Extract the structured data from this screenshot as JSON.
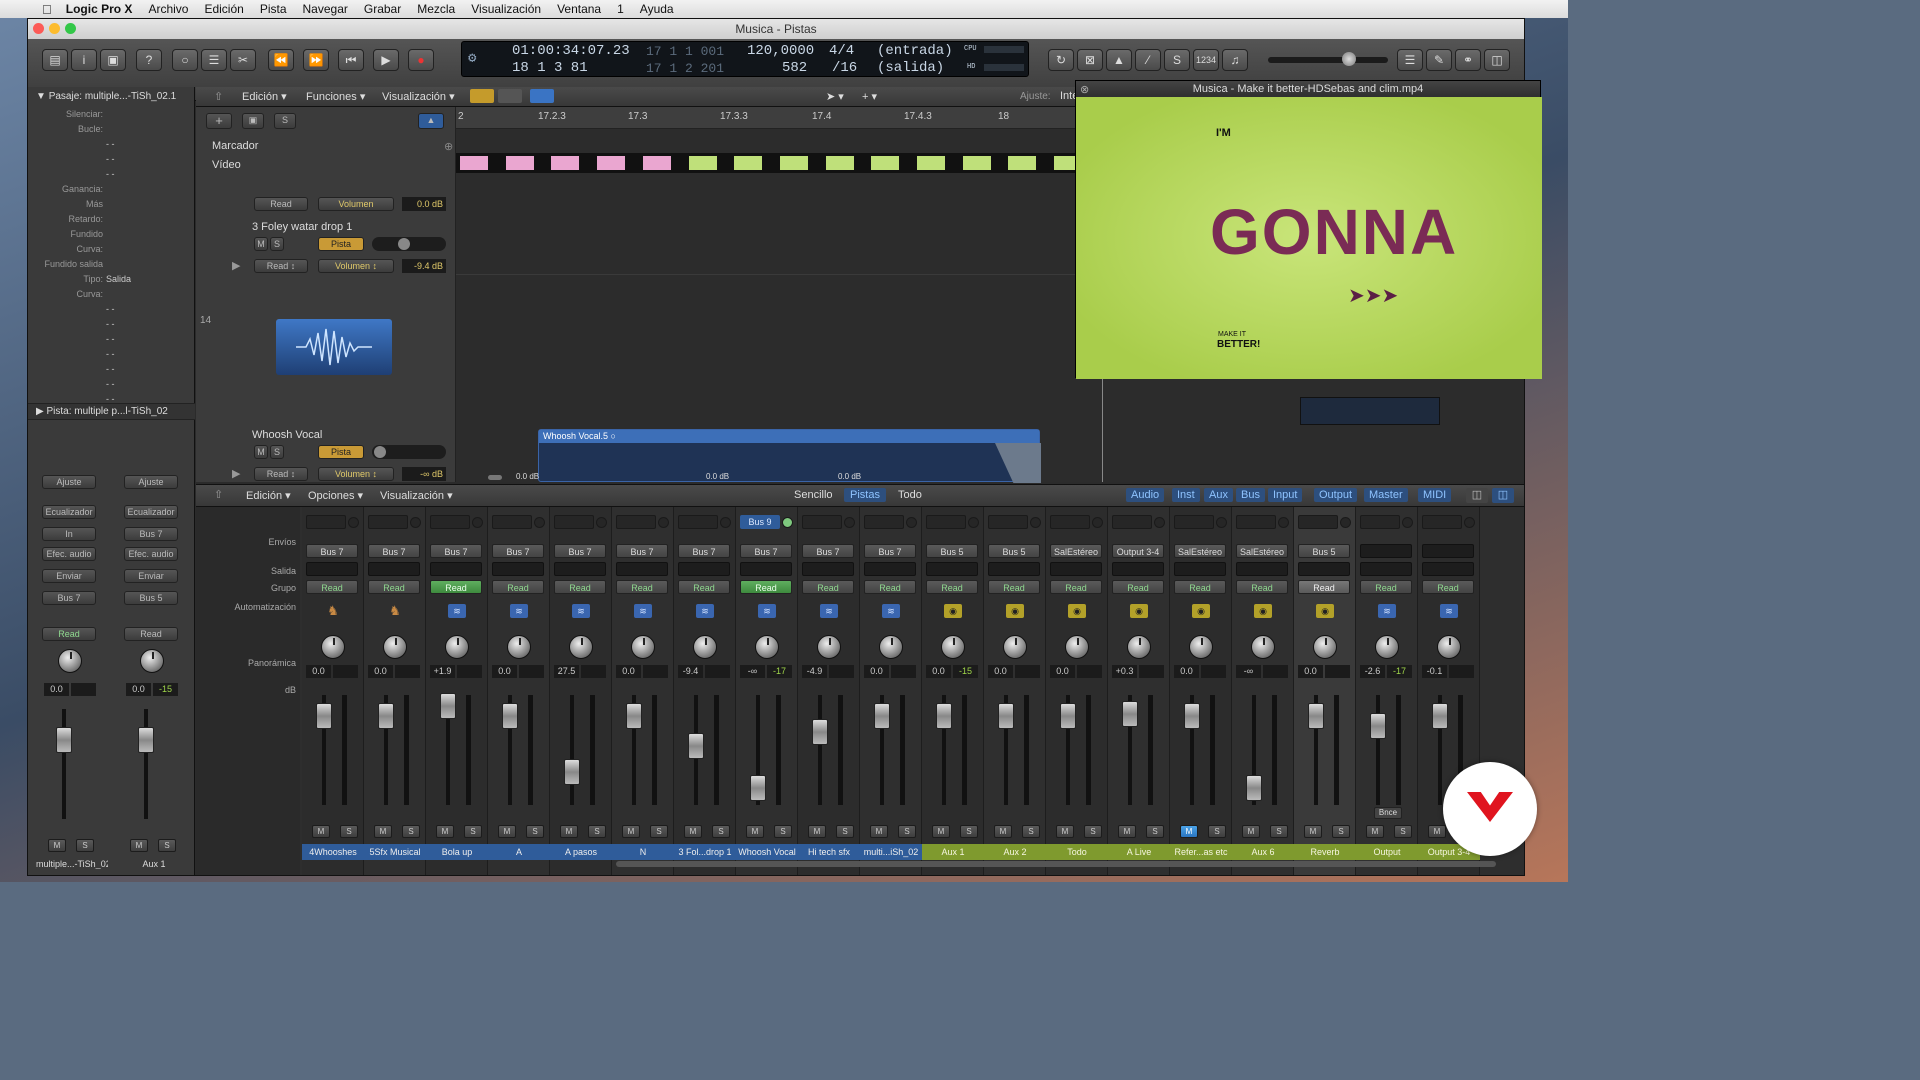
{
  "menubar": {
    "app": "Logic Pro X",
    "items": [
      "Archivo",
      "Edición",
      "Pista",
      "Navegar",
      "Grabar",
      "Mezcla",
      "Visualización",
      "Ventana",
      "1",
      "Ayuda"
    ]
  },
  "window": {
    "title": "Musica - Pistas"
  },
  "lcd": {
    "smpte": "01:00:34:07.23",
    "bars": "18  1  3   81",
    "loop_top": "17  1  1  001",
    "loop_bottom": "17  1  2  201",
    "tempo": "120,0000",
    "tempo_sub": "582",
    "sig": "4/4",
    "sig_sub": "/16",
    "in": "(entrada)",
    "out": "(salida)",
    "cpu": "CPU",
    "hd": "HD"
  },
  "toolbar": {
    "count_in": "1234"
  },
  "inspector": {
    "region_title": "Pasaje:  multiple...-TiSh_02.1",
    "rows": [
      {
        "label": "Silenciar:",
        "value": ""
      },
      {
        "label": "Bucle:",
        "value": ""
      },
      {
        "label": "",
        "value": "- -"
      },
      {
        "label": "",
        "value": "- -"
      },
      {
        "label": "",
        "value": "- -"
      },
      {
        "label": "Ganancia:",
        "value": ""
      },
      {
        "label": "Más",
        "value": ""
      },
      {
        "label": "Retardo:",
        "value": ""
      },
      {
        "label": "Fundido",
        "value": ""
      },
      {
        "label": "Curva:",
        "value": ""
      },
      {
        "label": "Fundido salida",
        "value": ""
      },
      {
        "label": "Tipo:",
        "value": "Salida"
      },
      {
        "label": "Curva:",
        "value": ""
      },
      {
        "label": "",
        "value": "- -"
      },
      {
        "label": "",
        "value": "- -"
      },
      {
        "label": "",
        "value": "- -"
      },
      {
        "label": "",
        "value": "- -"
      },
      {
        "label": "",
        "value": "- -"
      },
      {
        "label": "",
        "value": "- -"
      },
      {
        "label": "",
        "value": "- -"
      }
    ],
    "track_title": "Pista:  multiple p...l-TiSh_02",
    "strip1": {
      "ajuste": "Ajuste",
      "eq": "Ecualizador",
      "input": "In",
      "fx": "Efec. audio",
      "send": "Enviar",
      "out": "Bus 7",
      "auto": "Read",
      "db": "0.0",
      "pk": "",
      "name": "multiple...-TiSh_02"
    },
    "strip2": {
      "ajuste": "Ajuste",
      "eq": "Ecualizador",
      "input": "Bus 7",
      "fx": "Efec. audio",
      "send": "Enviar",
      "out": "Bus 5",
      "auto": "Read",
      "db": "0.0",
      "pk": "-15",
      "name": "Aux 1"
    }
  },
  "tracks": {
    "menu": [
      "Edición",
      "Funciones",
      "Visualización"
    ],
    "adjust_label": "Ajuste:",
    "adjust_value": "Intelige",
    "marker": "Marcador",
    "video": "Vídeo",
    "ruler": [
      "2",
      "17.2.3",
      "17.3",
      "17.3.3",
      "17.4",
      "17.4.3",
      "18"
    ],
    "track_number": "14",
    "t1": {
      "name": "3 Foley watar drop 1",
      "mode": "Read",
      "param": "Volumen",
      "value": "-9.4 dB",
      "pista": "Pista"
    },
    "t0": {
      "mode": "Read",
      "param": "Volumen",
      "value": "0.0 dB"
    },
    "t2": {
      "name": "Whoosh Vocal",
      "mode": "Read",
      "param": "Volumen",
      "value": "-∞ dB",
      "pista": "Pista"
    },
    "region": {
      "name": "Whoosh Vocal.5",
      "gains": [
        "0.0 dB",
        "0.0 dB",
        "0.0 dB"
      ]
    }
  },
  "mixer": {
    "menu": [
      "Edición",
      "Opciones",
      "Visualización"
    ],
    "views": [
      "Sencillo",
      "Pistas",
      "Todo"
    ],
    "active_view": "Pistas",
    "filters": [
      "Audio",
      "Inst",
      "Aux",
      "Bus",
      "Input",
      "Output",
      "Master",
      "MIDI"
    ],
    "row_labels": {
      "sends": "Envíos",
      "output": "Salida",
      "group": "Grupo",
      "auto": "Automatización",
      "pan": "Panorámica",
      "db": "dB"
    },
    "strips": [
      {
        "name": "4Whooshes",
        "out": "Bus 7",
        "auto": "Read",
        "db": "0.0",
        "pk": "",
        "icon": "horse",
        "color": "blue",
        "send": ""
      },
      {
        "name": "5Sfx Musical",
        "out": "Bus 7",
        "auto": "Read",
        "db": "0.0",
        "pk": "",
        "icon": "horse",
        "color": "blue",
        "send": ""
      },
      {
        "name": "Bola up",
        "out": "Bus 7",
        "auto": "Read",
        "db": "+1.9",
        "pk": "",
        "icon": "audio",
        "color": "blue",
        "send": ""
      },
      {
        "name": "A",
        "out": "Bus 7",
        "auto": "Read",
        "db": "0.0",
        "pk": "",
        "icon": "audio",
        "color": "blue",
        "send": ""
      },
      {
        "name": "A pasos",
        "out": "Bus 7",
        "auto": "Read",
        "db": "27.5",
        "pk": "",
        "icon": "audio",
        "color": "blue",
        "send": ""
      },
      {
        "name": "N",
        "out": "Bus 7",
        "auto": "Read",
        "db": "0.0",
        "pk": "",
        "icon": "audio",
        "color": "blue",
        "send": ""
      },
      {
        "name": "3 Fol...drop 1",
        "out": "Bus 7",
        "auto": "Read",
        "db": "-9.4",
        "pk": "",
        "icon": "audio",
        "color": "blue",
        "send": ""
      },
      {
        "name": "Whoosh Vocal",
        "out": "Bus 7",
        "auto": "Read",
        "db": "-∞",
        "pk": "-17",
        "icon": "audio",
        "color": "blue",
        "send": "Bus 9"
      },
      {
        "name": "Hi tech sfx",
        "out": "Bus 7",
        "auto": "Read",
        "db": "-4.9",
        "pk": "",
        "icon": "audio",
        "color": "blue",
        "send": ""
      },
      {
        "name": "multi...iSh_02",
        "out": "Bus 7",
        "auto": "Read",
        "db": "0.0",
        "pk": "",
        "icon": "audio",
        "color": "blue",
        "send": ""
      },
      {
        "name": "Aux 1",
        "out": "Bus 5",
        "auto": "Read",
        "db": "0.0",
        "pk": "-15",
        "icon": "aux",
        "color": "green",
        "send": ""
      },
      {
        "name": "Aux 2",
        "out": "Bus 5",
        "auto": "Read",
        "db": "0.0",
        "pk": "",
        "icon": "aux",
        "color": "green",
        "send": ""
      },
      {
        "name": "Todo",
        "out": "SalEstéreo",
        "auto": "Read",
        "db": "0.0",
        "pk": "",
        "icon": "aux",
        "color": "green",
        "send": ""
      },
      {
        "name": "A Live",
        "out": "Output 3-4",
        "auto": "Read",
        "db": "+0.3",
        "pk": "",
        "icon": "aux",
        "color": "green",
        "send": ""
      },
      {
        "name": "Refer...as etc",
        "out": "SalEstéreo",
        "auto": "Read",
        "db": "0.0",
        "pk": "",
        "icon": "aux",
        "color": "green",
        "send": ""
      },
      {
        "name": "Aux 6",
        "out": "SalEstéreo",
        "auto": "Read",
        "db": "-∞",
        "pk": "",
        "icon": "aux",
        "color": "green",
        "send": ""
      },
      {
        "name": "Reverb",
        "out": "Bus 5",
        "auto": "Read",
        "db": "0.0",
        "pk": "",
        "icon": "aux",
        "color": "green",
        "send": ""
      },
      {
        "name": "Output",
        "out": "",
        "auto": "Read",
        "db": "-2.6",
        "pk": "-17",
        "icon": "audio",
        "color": "green",
        "send": ""
      },
      {
        "name": "Output 3-4",
        "out": "",
        "auto": "Read",
        "db": "-0.1",
        "pk": "",
        "icon": "audio",
        "color": "green",
        "send": ""
      }
    ],
    "bnce": "Bnce"
  },
  "video": {
    "title": "Musica - Make it better-HDSebas and clim.mp4",
    "word_top": "I'M",
    "word_main": "GONNA",
    "word_bottom": "BETTER!",
    "word_small": "MAKE IT"
  }
}
